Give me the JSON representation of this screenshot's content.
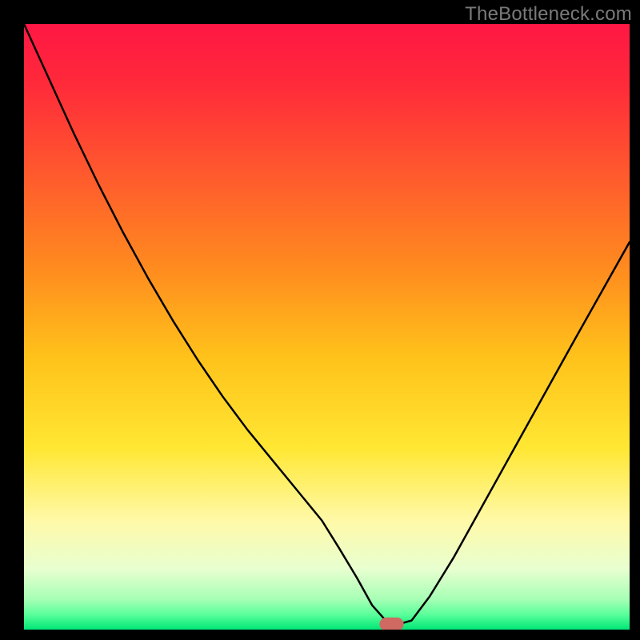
{
  "watermark": "TheBottleneck.com",
  "plot": {
    "inner_left": 30,
    "inner_top": 30,
    "inner_width": 757,
    "inner_height": 757
  },
  "chart_data": {
    "type": "line",
    "title": "",
    "xlabel": "",
    "ylabel": "",
    "xlim": [
      0,
      100
    ],
    "ylim": [
      0,
      100
    ],
    "gradient_stops": [
      {
        "offset": 0.0,
        "color": "#ff1744"
      },
      {
        "offset": 0.1,
        "color": "#ff2a3a"
      },
      {
        "offset": 0.25,
        "color": "#ff5a2d"
      },
      {
        "offset": 0.4,
        "color": "#ff8a1f"
      },
      {
        "offset": 0.55,
        "color": "#ffc21a"
      },
      {
        "offset": 0.7,
        "color": "#ffe733"
      },
      {
        "offset": 0.82,
        "color": "#fff9a8"
      },
      {
        "offset": 0.9,
        "color": "#e8ffd0"
      },
      {
        "offset": 0.95,
        "color": "#a6ffb5"
      },
      {
        "offset": 0.975,
        "color": "#5aff9a"
      },
      {
        "offset": 1.0,
        "color": "#00e676"
      }
    ],
    "series": [
      {
        "name": "bottleneck-curve",
        "x": [
          0.0,
          4.1,
          8.2,
          12.3,
          16.4,
          20.5,
          24.6,
          28.7,
          32.8,
          36.9,
          41.0,
          45.1,
          49.2,
          52.0,
          55.0,
          57.5,
          60.0,
          61.5,
          64.0,
          67.0,
          71.0,
          76.0,
          81.0,
          86.0,
          91.0,
          95.5,
          100.0
        ],
        "y": [
          100.0,
          91.0,
          82.0,
          73.5,
          65.5,
          58.0,
          51.0,
          44.5,
          38.5,
          33.0,
          28.0,
          23.0,
          18.0,
          13.5,
          8.5,
          4.0,
          1.2,
          0.8,
          1.5,
          5.5,
          12.0,
          21.0,
          30.0,
          39.0,
          48.0,
          56.0,
          64.0
        ]
      }
    ],
    "marker": {
      "name": "optimal-point",
      "x": 60.7,
      "y": 0.9,
      "rx": 2.0,
      "ry": 1.1,
      "color": "#cf6a63"
    }
  }
}
